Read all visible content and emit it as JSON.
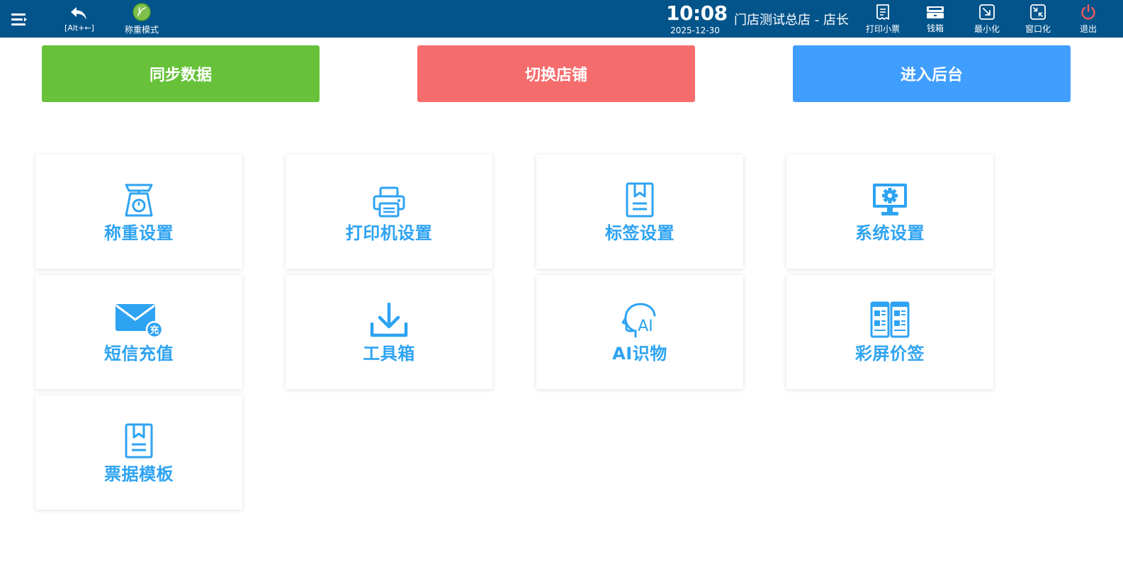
{
  "topbar": {
    "undo_hint": "[Alt+←]",
    "weigh_mode_label": "称重模式",
    "time": "10:08",
    "date": "2025-12-30",
    "store_title": "门店测试总店 - 店长",
    "print_receipt_label": "打印小票",
    "cash_drawer_label": "钱箱",
    "minimize_label": "最小化",
    "windowed_label": "窗口化",
    "exit_label": "退出",
    "bg_color": "#03548b",
    "exit_color": "#ff5a5a"
  },
  "actions": {
    "sync": "同步数据",
    "switch_store": "切换店铺",
    "enter_admin": "进入后台",
    "colors": {
      "sync": "#67c23a",
      "switch_store": "#f56c6c",
      "enter_admin": "#409eff"
    }
  },
  "tiles": [
    {
      "label": "称重设置",
      "icon": "scale-icon"
    },
    {
      "label": "打印机设置",
      "icon": "printer-icon"
    },
    {
      "label": "标签设置",
      "icon": "bookmark-icon"
    },
    {
      "label": "系统设置",
      "icon": "monitor-gear-icon"
    },
    {
      "label": "短信充值",
      "icon": "mail-recharge-icon"
    },
    {
      "label": "工具箱",
      "icon": "download-icon"
    },
    {
      "label": "AI识物",
      "icon": "ai-head-icon"
    },
    {
      "label": "彩屏价签",
      "icon": "dual-screen-icon"
    },
    {
      "label": "票据模板",
      "icon": "bookmark-icon"
    }
  ],
  "accent_color": "#2ea3f2"
}
